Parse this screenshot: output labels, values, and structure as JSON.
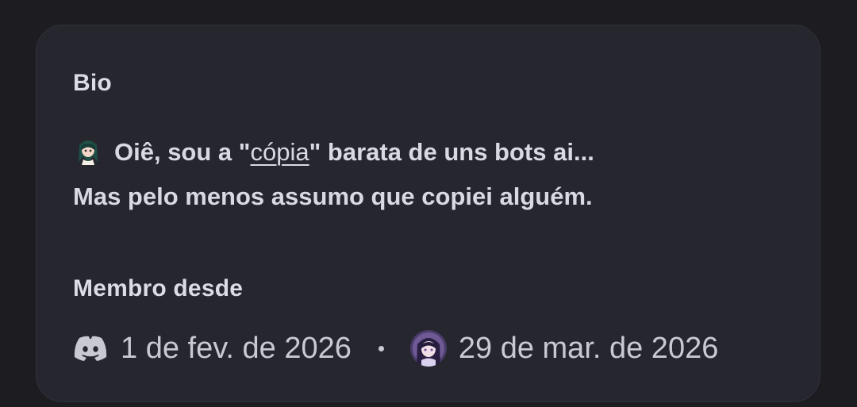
{
  "bio": {
    "title": "Bio",
    "line1_prefix": "Oiê, sou a \"",
    "link_text": "cópia",
    "line1_suffix": "\" barata de uns bots ai...",
    "line2": "Mas pelo menos assumo que copiei alguém."
  },
  "member_since": {
    "title": "Membro desde",
    "discord_icon": "discord-icon",
    "discord_date": "1 de fev. de 2026",
    "separator": "•",
    "server_icon": "server-avatar",
    "server_date": "29 de mar. de 2026"
  },
  "colors": {
    "background": "#1c1c21",
    "card": "#26262f",
    "text": "#d9d9e2",
    "muted_text": "#c9c9d3"
  }
}
